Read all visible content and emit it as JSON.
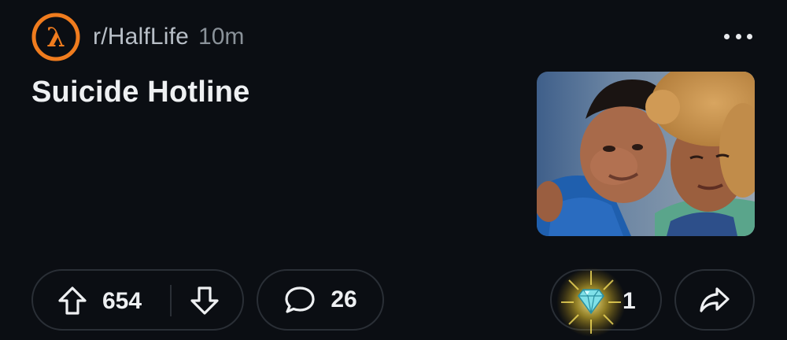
{
  "post": {
    "subreddit": "r/HalfLife",
    "time": "10m",
    "title": "Suicide Hotline"
  },
  "actions": {
    "upvotes": "654",
    "comments": "26",
    "awards": "1"
  },
  "icons": {
    "subreddit_avatar": "lambda-logo-icon",
    "more": "more-options-icon",
    "upvote": "arrow-up-icon",
    "downvote": "arrow-down-icon",
    "comment": "speech-bubble-icon",
    "award": "diamond-award-icon",
    "share": "share-arrow-icon"
  },
  "colors": {
    "background": "#0b0e13",
    "logo_orange": "#f07c1e",
    "text_muted": "#b8bfc7",
    "pill_border": "#2a2f36"
  }
}
